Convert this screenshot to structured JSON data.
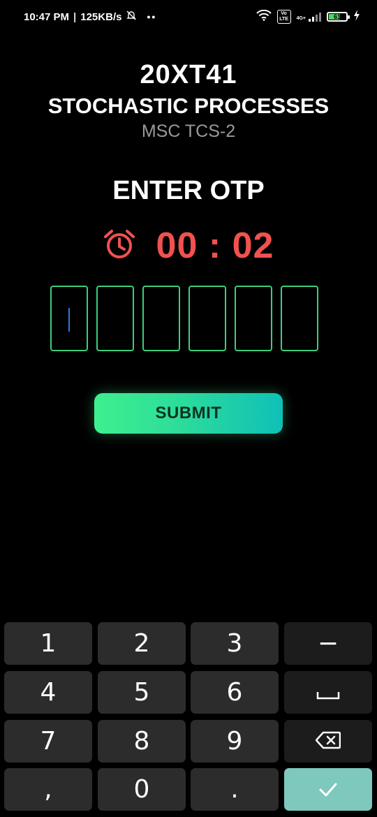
{
  "status_bar": {
    "time": "10:47 PM",
    "speed": "125KB/s",
    "dots": "••",
    "volte": "Vo LTE",
    "network": "4G+",
    "battery": "61"
  },
  "header": {
    "course_code": "20XT41",
    "course_name": "STOCHASTIC PROCESSES",
    "program": "MSC TCS-2"
  },
  "otp": {
    "title": "ENTER OTP",
    "timer": "00 : 02",
    "timer_color": "#f0524f",
    "box_count": 6,
    "submit_label": "SUBMIT"
  },
  "keyboard": {
    "keys": [
      "1",
      "2",
      "3",
      "−",
      "4",
      "5",
      "6",
      "␣",
      "7",
      "8",
      "9",
      "⌫",
      ",",
      "0",
      ".",
      "✓"
    ]
  },
  "colors": {
    "accent_green": "#3bcf7e",
    "submit_gradient_start": "#3ef08e",
    "submit_gradient_end": "#0fc0b8",
    "done_key": "#7ec8bd"
  }
}
